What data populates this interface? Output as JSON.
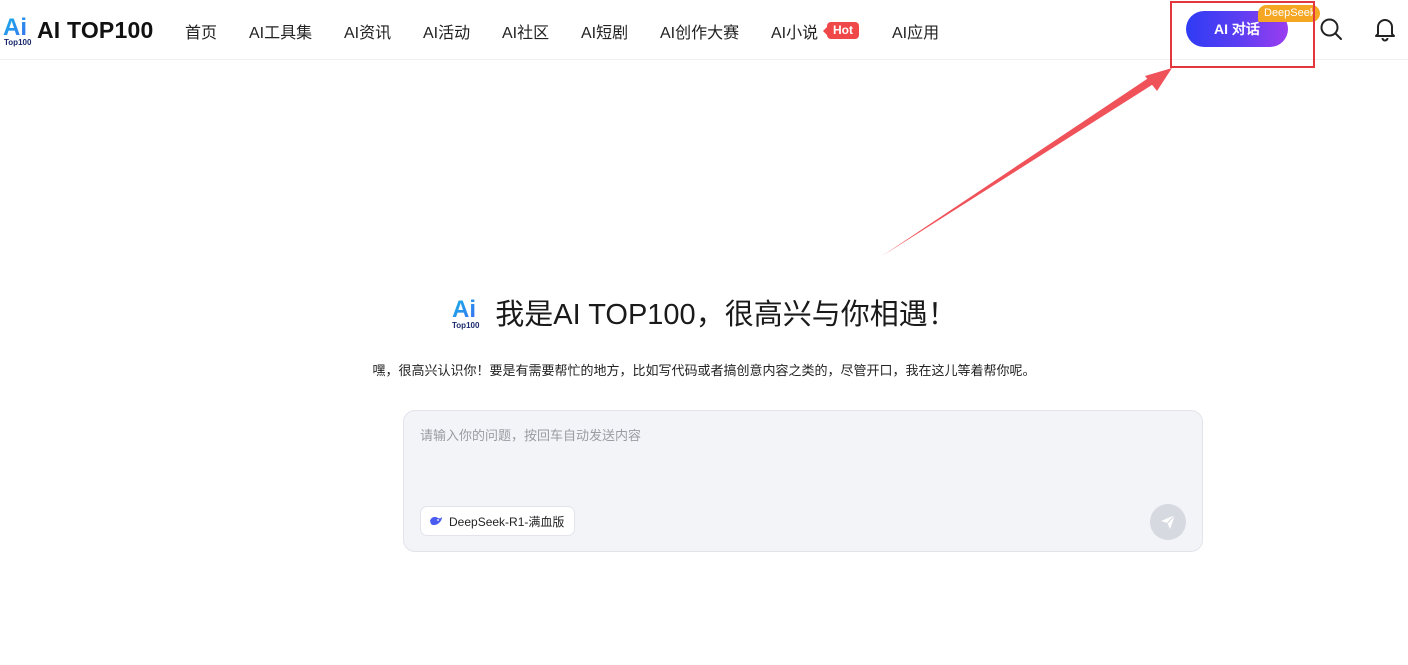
{
  "header": {
    "logo_text": "AI TOP100",
    "logo_mark_top": "Ai",
    "logo_mark_bottom": "Top100",
    "nav": [
      {
        "label": "首页"
      },
      {
        "label": "AI工具集"
      },
      {
        "label": "AI资讯"
      },
      {
        "label": "AI活动"
      },
      {
        "label": "AI社区"
      },
      {
        "label": "AI短剧"
      },
      {
        "label": "AI创作大赛"
      },
      {
        "label": "AI小说"
      },
      {
        "label": "AI应用"
      }
    ],
    "hot_badge": "Hot",
    "ai_chat_button": "AI 对话",
    "deepseek_tag": "DeepSeek",
    "icons": {
      "search": "search-icon",
      "bell": "bell-icon"
    }
  },
  "hero": {
    "title": "我是AI TOP100，很高兴与你相遇！",
    "subtitle": "嘿，很高兴认识你！要是有需要帮忙的地方，比如写代码或者搞创意内容之类的，尽管开口，我在这儿等着帮你呢。"
  },
  "chat": {
    "placeholder": "请输入你的问题，按回车自动发送内容",
    "value": "",
    "model_label": "DeepSeek-R1-满血版"
  },
  "colors": {
    "accent_start": "#2f3cf5",
    "accent_end": "#9b3df0",
    "hot": "#f04848",
    "deepseek_tag": "#f5a623",
    "annotation": "#e4373d"
  }
}
